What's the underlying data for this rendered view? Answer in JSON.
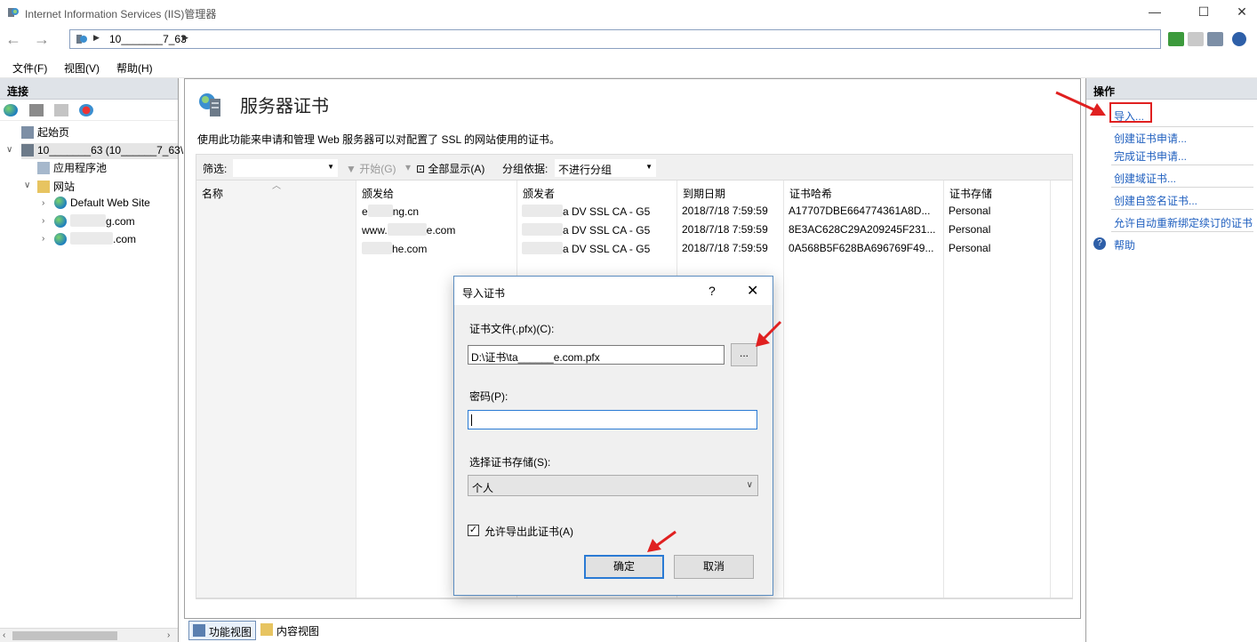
{
  "window": {
    "title": "Internet Information Services (IIS)管理器",
    "minimize": "—",
    "maximize": "☐",
    "close": "✕"
  },
  "address": {
    "crumb": "10_______7_63",
    "back": "←",
    "forward": "→"
  },
  "menu": [
    "文件(F)",
    "视图(V)",
    "帮助(H)"
  ],
  "connections": {
    "header": "连接",
    "tree": {
      "start_page": "起始页",
      "server": "10_______63 (10______7_63\\",
      "app_pools": "应用程序池",
      "sites": "网站",
      "default_site": "Default Web Site",
      "site2_suffix": "g.com",
      "site3_suffix": ".com"
    }
  },
  "center": {
    "title": "服务器证书",
    "description": "使用此功能来申请和管理 Web 服务器可以对配置了 SSL 的网站使用的证书。",
    "filter_label": "筛选:",
    "start_label": "开始(G)",
    "show_all_label": "全部显示(A)",
    "group_label": "分组依据:",
    "group_value": "不进行分组",
    "columns": [
      "名称",
      "颁发给",
      "颁发者",
      "到期日期",
      "证书哈希",
      "证书存储"
    ],
    "rows": [
      {
        "issued_to_prefix": "e",
        "issued_to_suffix": "ng.cn",
        "issuer_suffix": "a DV SSL CA - G5",
        "expiry": "2018/7/18 7:59:59",
        "hash": "A17707DBE664774361A8D...",
        "store": "Personal"
      },
      {
        "issued_to_prefix": "www.",
        "issued_to_suffix": "e.com",
        "issuer_suffix": "a DV SSL CA - G5",
        "expiry": "2018/7/18 7:59:59",
        "hash": "8E3AC628C29A209245F231...",
        "store": "Personal"
      },
      {
        "issued_to_prefix": "",
        "issued_to_suffix": "he.com",
        "issuer_suffix": "a DV SSL CA - G5",
        "expiry": "2018/7/18 7:59:59",
        "hash": "0A568B5F628BA696769F49...",
        "store": "Personal"
      }
    ]
  },
  "view_tabs": [
    "功能视图",
    "内容视图"
  ],
  "actions": {
    "header": "操作",
    "items": [
      "导入...",
      "创建证书申请...",
      "完成证书申请...",
      "创建域证书...",
      "创建自签名证书...",
      "允许自动重新绑定续订的证书",
      "帮助"
    ]
  },
  "dialog": {
    "title": "导入证书",
    "help": "?",
    "close": "✕",
    "file_label": "证书文件(.pfx)(C):",
    "file_value": "D:\\证书\\ta______e.com.pfx",
    "browse": "...",
    "password_label": "密码(P):",
    "password_value": "",
    "store_label": "选择证书存储(S):",
    "store_value": "个人",
    "export_label": "允许导出此证书(A)",
    "export_checked": "✓",
    "ok": "确定",
    "cancel": "取消"
  },
  "colors": {
    "link": "#1f5fbf",
    "annotation": "#e02020",
    "header_bg": "#dfe3e8"
  }
}
